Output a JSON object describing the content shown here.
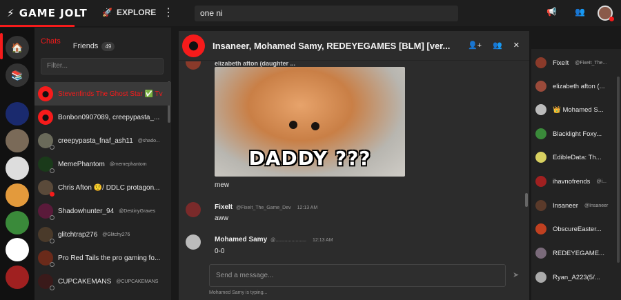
{
  "topbar": {
    "logo": "GAME JOLT",
    "explore_label": "EXPLORE",
    "search_value": "one ni",
    "icons": [
      "broadcast-icon",
      "user-group-icon"
    ]
  },
  "leftrail": {
    "icons": [
      "lobby-icon",
      "library-icon"
    ]
  },
  "chatlist": {
    "tabs": {
      "chats": "Chats",
      "friends": "Friends",
      "friends_count": "49"
    },
    "filter_placeholder": "Filter...",
    "items": [
      {
        "name": "Stevenfinds The Ghost Star ✅ Tv",
        "sub": "",
        "selected": true,
        "group": true
      },
      {
        "name": "Bonbon0907089, creepypasta_...",
        "sub": "",
        "group": true
      },
      {
        "name": "creepypasta_fnaf_ash11",
        "sub": "@shado..."
      },
      {
        "name": "MemePhantom",
        "sub": "@memephantom"
      },
      {
        "name": "Chris Afton 🤨/ DDLC protagon...",
        "sub": ""
      },
      {
        "name": "Shadowhunter_94",
        "sub": "@DestinyGraves"
      },
      {
        "name": "glitchtrap276",
        "sub": "@Glitchy276"
      },
      {
        "name": "Pro Red Tails the pro gaming fo...",
        "sub": ""
      },
      {
        "name": "CUPCAKEMANS",
        "sub": "@CUPCAKEMANS"
      }
    ]
  },
  "chat": {
    "title": "Insaneer, Mohamed Samy, REDEYEGAMES [BLM] [ver...",
    "header_icons": [
      "add-member-icon",
      "members-icon",
      "close-icon"
    ],
    "cut_author": "elizabeth afton (daughter ...",
    "gif_caption": "DADDY ???",
    "messages": [
      {
        "text": "mew"
      },
      {
        "author": "FixeIt",
        "handle": "@FixeIt_The_Game_Dev",
        "time": "12:13 AM",
        "text": "aww"
      },
      {
        "author": "Mohamed Samy",
        "handle": "@.......................",
        "time": "12:13 AM",
        "text": "0-0"
      }
    ],
    "composer_placeholder": "Send a message...",
    "typing": "Mohamed Samy is typing..."
  },
  "members": [
    {
      "name": "FixeIt",
      "sub": "@FixeIt_The..."
    },
    {
      "name": "elizabeth afton (...",
      "sub": ""
    },
    {
      "name": "👑 Mohamed S...",
      "sub": ""
    },
    {
      "name": "Blacklight Foxy...",
      "sub": ""
    },
    {
      "name": "EdibleData: Th...",
      "sub": ""
    },
    {
      "name": "ihavnofrends",
      "sub": "@i..."
    },
    {
      "name": "Insaneer",
      "sub": "@Insaneer"
    },
    {
      "name": "ObscureEaster...",
      "sub": ""
    },
    {
      "name": "REDEYEGAME...",
      "sub": ""
    },
    {
      "name": "Ryan_A223(5/...",
      "sub": ""
    }
  ],
  "colors": {
    "accent": "#f61b1b",
    "background": "#191919",
    "panel": "#2c2c2c"
  }
}
